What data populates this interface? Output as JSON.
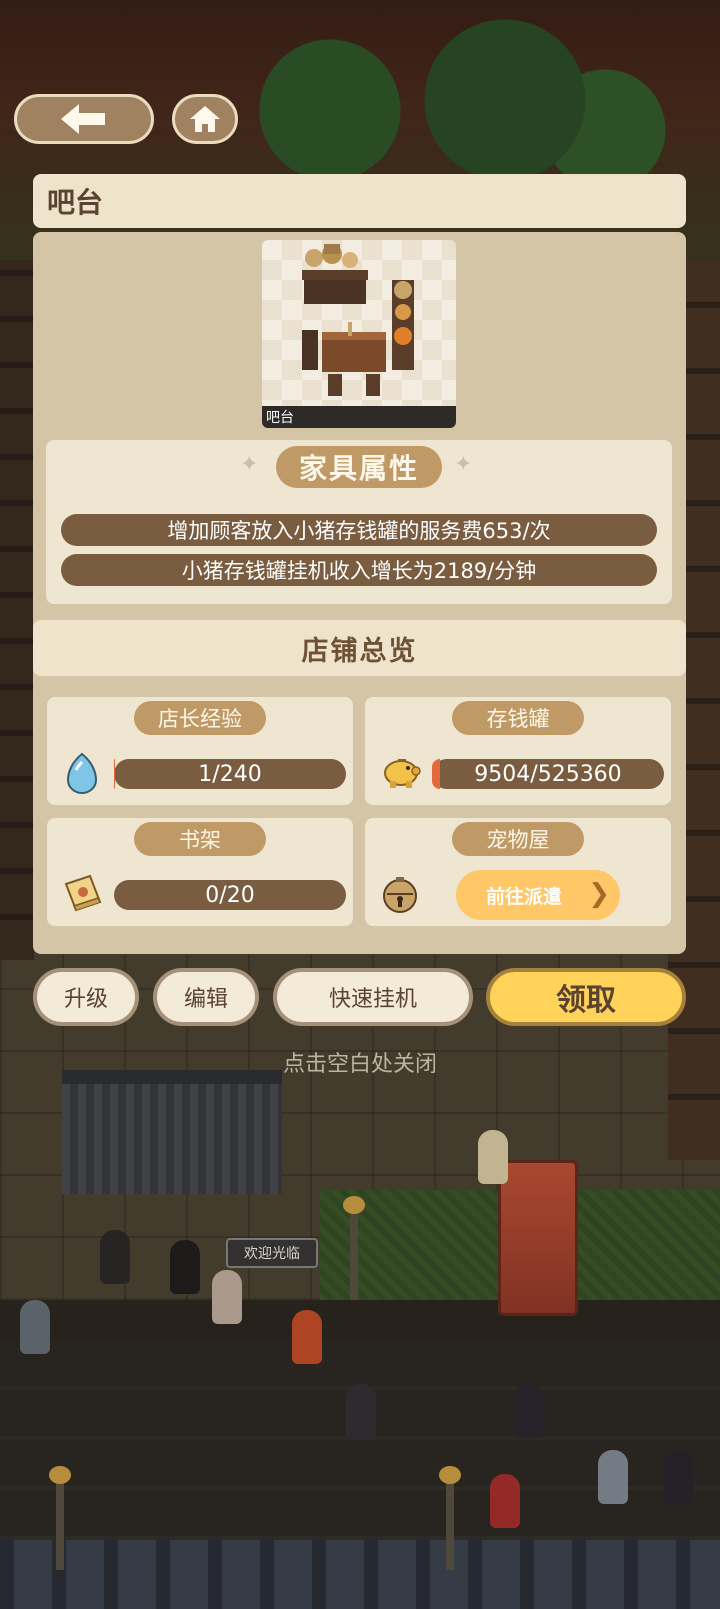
{
  "nav": {
    "back_icon": "arrow-left-icon",
    "home_icon": "home-icon"
  },
  "item": {
    "title": "吧台",
    "thumb_label": "吧台"
  },
  "attributes": {
    "title": "家具属性",
    "rows": [
      "增加顾客放入小猪存钱罐的服务费653/次",
      "小猪存钱罐挂机收入增长为2189/分钟"
    ]
  },
  "overview": {
    "title": "店铺总览",
    "cards": [
      {
        "tag": "店长经验",
        "value": "1/240",
        "icon": "crystal-drop-icon",
        "progress": 0.004
      },
      {
        "tag": "存钱罐",
        "value": "9504/525360",
        "icon": "piggy-bank-icon",
        "progress": 0.018
      },
      {
        "tag": "书架",
        "value": "0/20",
        "icon": "book-icon",
        "progress": 0
      },
      {
        "tag": "宠物屋",
        "button": "前往派遣",
        "icon": "bell-icon"
      }
    ]
  },
  "actions": {
    "upgrade": "升级",
    "edit": "编辑",
    "quick_idle": "快速挂机",
    "claim": "领取"
  },
  "hint": "点击空白处关闭",
  "scene": {
    "welcome_sign": "欢迎光临"
  },
  "colors": {
    "panel": "#d4c5a6",
    "tag": "#c09a66",
    "bar": "#7a5c40",
    "claim": "#ffd35a",
    "go": "#ffc768"
  }
}
